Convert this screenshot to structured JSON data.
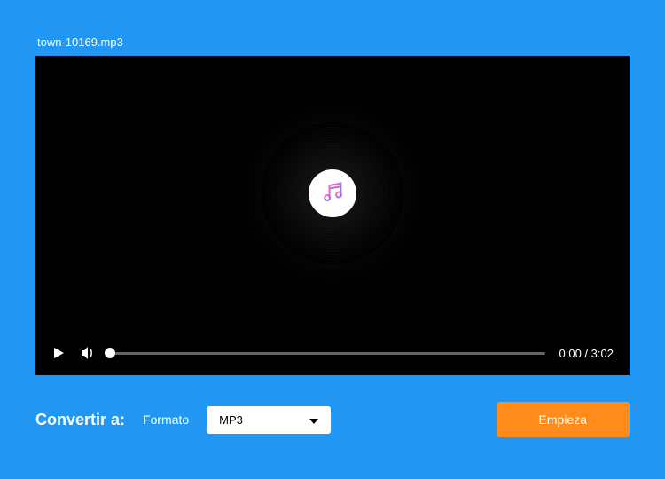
{
  "filename": "town-10169.mp3",
  "player": {
    "current_time": "0:00",
    "duration": "3:02",
    "time_display": "0:00 / 3:02"
  },
  "convert": {
    "label": "Convertir a:",
    "format_label": "Formato",
    "format_selected": "MP3",
    "start_button": "Empieza"
  }
}
